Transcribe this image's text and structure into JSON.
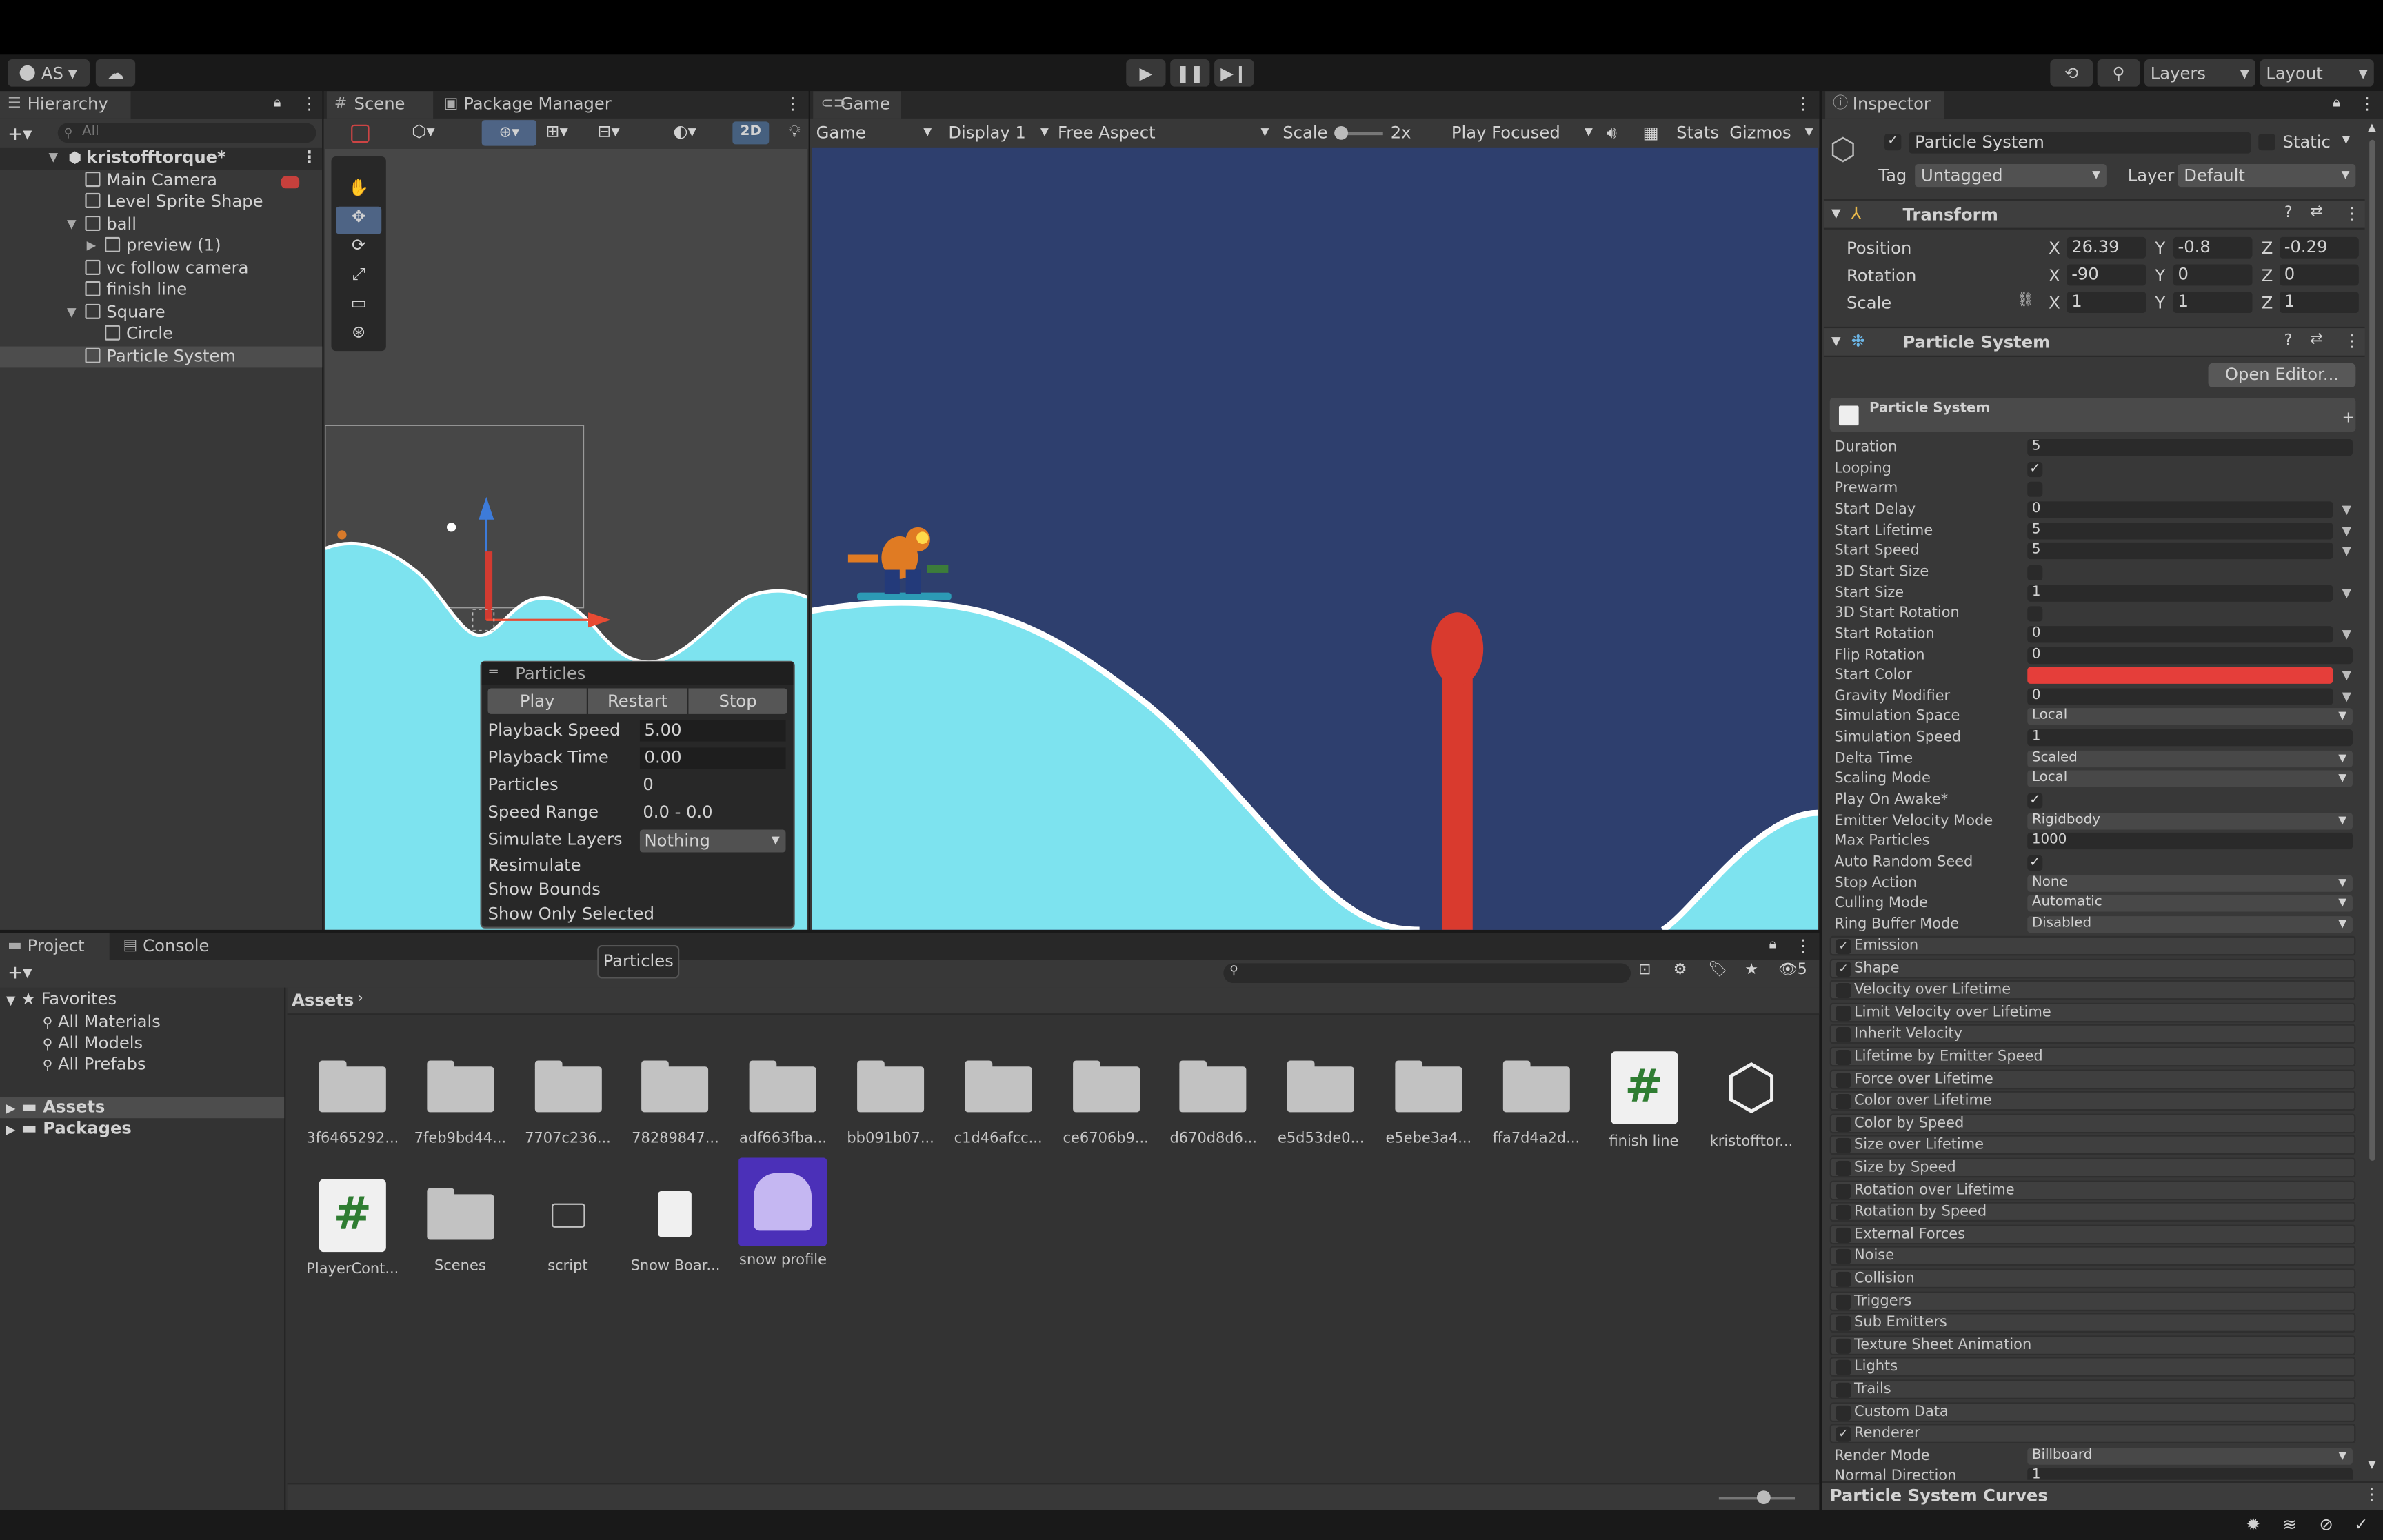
{
  "toolbar": {
    "account": "AS",
    "layers": "Layers",
    "layout": "Layout"
  },
  "scene_tabs": {
    "scene": "Scene",
    "package_manager": "Package Manager",
    "btn_2d": "2D"
  },
  "game": {
    "tab": "Game",
    "view_select": "Game",
    "display": "Display 1",
    "aspect": "Free Aspect",
    "scale_label": "Scale",
    "scale_value": "2x",
    "play_focused": "Play Focused",
    "stats": "Stats",
    "gizmos": "Gizmos"
  },
  "hierarchy": {
    "tab": "Hierarchy",
    "search_placeholder": "All",
    "scene_name": "kristofftorque*",
    "items": [
      "Main Camera",
      "Level Sprite Shape",
      "ball",
      "preview (1)",
      "vc follow camera",
      "finish line",
      "Square",
      "Circle",
      "Particle System"
    ]
  },
  "particles_overlay": {
    "title": "Particles",
    "play": "Play",
    "restart": "Restart",
    "stop": "Stop",
    "rows": [
      {
        "label": "Playback Speed",
        "value": "5.00"
      },
      {
        "label": "Playback Time",
        "value": "0.00"
      },
      {
        "label": "Particles",
        "value": "0"
      },
      {
        "label": "Speed Range",
        "value": "0.0 - 0.0"
      },
      {
        "label": "Simulate Layers",
        "value": "Nothing"
      }
    ],
    "resimulate": "Resimulate",
    "show_bounds": "Show Bounds",
    "show_only_selected": "Show Only Selected",
    "resimulate_checked": true
  },
  "project": {
    "tab": "Project",
    "console": "Console",
    "tooltip": "Particles",
    "favorites": "Favorites",
    "fav_items": [
      "All Materials",
      "All Models",
      "All Prefabs"
    ],
    "assets": "Assets",
    "packages": "Packages",
    "breadcrumb": "Assets",
    "hidden_count": "5",
    "items": [
      {
        "name": "3f6465292...",
        "kind": "folder"
      },
      {
        "name": "7feb9bd44...",
        "kind": "folder"
      },
      {
        "name": "7707c236...",
        "kind": "folder"
      },
      {
        "name": "78289847...",
        "kind": "folder"
      },
      {
        "name": "adf663fba...",
        "kind": "folder"
      },
      {
        "name": "bb091b07...",
        "kind": "folder"
      },
      {
        "name": "c1d46afcc...",
        "kind": "folder"
      },
      {
        "name": "ce6706b9...",
        "kind": "folder"
      },
      {
        "name": "d670d8d6...",
        "kind": "folder"
      },
      {
        "name": "e5d53de0...",
        "kind": "folder"
      },
      {
        "name": "e5ebe3a4...",
        "kind": "folder"
      },
      {
        "name": "ffa7d4a2d...",
        "kind": "folder"
      },
      {
        "name": "finish line",
        "kind": "script"
      },
      {
        "name": "kristofftor...",
        "kind": "unity"
      },
      {
        "name": "PlayerCont...",
        "kind": "script"
      },
      {
        "name": "Scenes",
        "kind": "folder"
      },
      {
        "name": "script",
        "kind": "emptyfolder"
      },
      {
        "name": "Snow Boar...",
        "kind": "file"
      },
      {
        "name": "snow profile",
        "kind": "material"
      }
    ]
  },
  "inspector": {
    "tab": "Inspector",
    "object_name": "Particle System",
    "static": "Static",
    "tag_label": "Tag",
    "tag_value": "Untagged",
    "layer_label": "Layer",
    "layer_value": "Default",
    "transform": {
      "title": "Transform",
      "position": {
        "label": "Position",
        "x": "26.39",
        "y": "-0.8",
        "z": "-0.29"
      },
      "rotation": {
        "label": "Rotation",
        "x": "-90",
        "y": "0",
        "z": "0"
      },
      "scale": {
        "label": "Scale",
        "x": "1",
        "y": "1",
        "z": "1"
      }
    },
    "ps_title": "Particle System",
    "open_editor": "Open Editor...",
    "ps_header": "Particle System",
    "start_color": "#e53e3a",
    "props": [
      {
        "label": "Duration",
        "type": "field",
        "value": "5"
      },
      {
        "label": "Looping",
        "type": "check",
        "value": "✓"
      },
      {
        "label": "Prewarm",
        "type": "check",
        "value": ""
      },
      {
        "label": "Start Delay",
        "type": "fieldarrow",
        "value": "0"
      },
      {
        "label": "Start Lifetime",
        "type": "fieldarrow",
        "value": "5"
      },
      {
        "label": "Start Speed",
        "type": "fieldarrow",
        "value": "5"
      },
      {
        "label": "3D Start Size",
        "type": "check",
        "value": ""
      },
      {
        "label": "Start Size",
        "type": "fieldarrow",
        "value": "1"
      },
      {
        "label": "3D Start Rotation",
        "type": "check",
        "value": ""
      },
      {
        "label": "Start Rotation",
        "type": "fieldarrow",
        "value": "0"
      },
      {
        "label": "Flip Rotation",
        "type": "field",
        "value": "0"
      },
      {
        "label": "Start Color",
        "type": "color",
        "value": ""
      },
      {
        "label": "Gravity Modifier",
        "type": "fieldarrow",
        "value": "0"
      },
      {
        "label": "Simulation Space",
        "type": "dropdown",
        "value": "Local"
      },
      {
        "label": "Simulation Speed",
        "type": "field",
        "value": "1"
      },
      {
        "label": "Delta Time",
        "type": "dropdown",
        "value": "Scaled"
      },
      {
        "label": "Scaling Mode",
        "type": "dropdown",
        "value": "Local"
      },
      {
        "label": "Play On Awake*",
        "type": "check",
        "value": "✓"
      },
      {
        "label": "Emitter Velocity Mode",
        "type": "dropdown",
        "value": "Rigidbody"
      },
      {
        "label": "Max Particles",
        "type": "field",
        "value": "1000"
      },
      {
        "label": "Auto Random Seed",
        "type": "check",
        "value": "✓"
      },
      {
        "label": "Stop Action",
        "type": "dropdown",
        "value": "None"
      },
      {
        "label": "Culling Mode",
        "type": "dropdown",
        "value": "Automatic"
      },
      {
        "label": "Ring Buffer Mode",
        "type": "dropdown",
        "value": "Disabled"
      }
    ],
    "modules": [
      {
        "name": "Emission",
        "on": true
      },
      {
        "name": "Shape",
        "on": true
      },
      {
        "name": "Velocity over Lifetime",
        "on": false
      },
      {
        "name": "Limit Velocity over Lifetime",
        "on": false
      },
      {
        "name": "Inherit Velocity",
        "on": false
      },
      {
        "name": "Lifetime by Emitter Speed",
        "on": false
      },
      {
        "name": "Force over Lifetime",
        "on": false
      },
      {
        "name": "Color over Lifetime",
        "on": false
      },
      {
        "name": "Color by Speed",
        "on": false
      },
      {
        "name": "Size over Lifetime",
        "on": false
      },
      {
        "name": "Size by Speed",
        "on": false
      },
      {
        "name": "Rotation over Lifetime",
        "on": false
      },
      {
        "name": "Rotation by Speed",
        "on": false
      },
      {
        "name": "External Forces",
        "on": false
      },
      {
        "name": "Noise",
        "on": false
      },
      {
        "name": "Collision",
        "on": false
      },
      {
        "name": "Triggers",
        "on": false
      },
      {
        "name": "Sub Emitters",
        "on": false
      },
      {
        "name": "Texture Sheet Animation",
        "on": false
      },
      {
        "name": "Lights",
        "on": false
      },
      {
        "name": "Trails",
        "on": false
      },
      {
        "name": "Custom Data",
        "on": false
      },
      {
        "name": "Renderer",
        "on": true
      }
    ],
    "render_mode_label": "Render Mode",
    "render_mode_value": "Billboard",
    "normal_direction_label": "Normal Direction",
    "normal_direction_value": "1",
    "curves": "Particle System Curves"
  },
  "colors": {
    "snow": "#7de3ef",
    "sky": "#2e3f6e",
    "scene_bg": "#474747",
    "red": "#d93a2e"
  }
}
